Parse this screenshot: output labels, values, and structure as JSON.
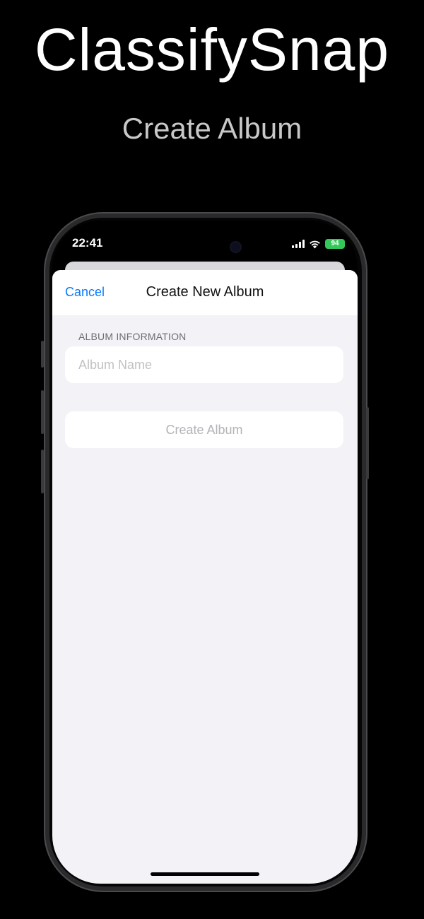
{
  "promo": {
    "title": "ClassifySnap",
    "subtitle": "Create Album"
  },
  "status_bar": {
    "time": "22:41",
    "battery": "94",
    "icons": [
      "signal-icon",
      "wifi-icon",
      "battery-icon"
    ]
  },
  "nav": {
    "cancel_label": "Cancel",
    "title": "Create New Album"
  },
  "form": {
    "section_header": "ALBUM INFORMATION",
    "album_name_value": "",
    "album_name_placeholder": "Album Name",
    "create_label": "Create Album"
  },
  "colors": {
    "accent": "#0a7aff",
    "background": "#f2f2f7",
    "battery": "#34c759",
    "disabled_text": "#b3b3b8"
  }
}
